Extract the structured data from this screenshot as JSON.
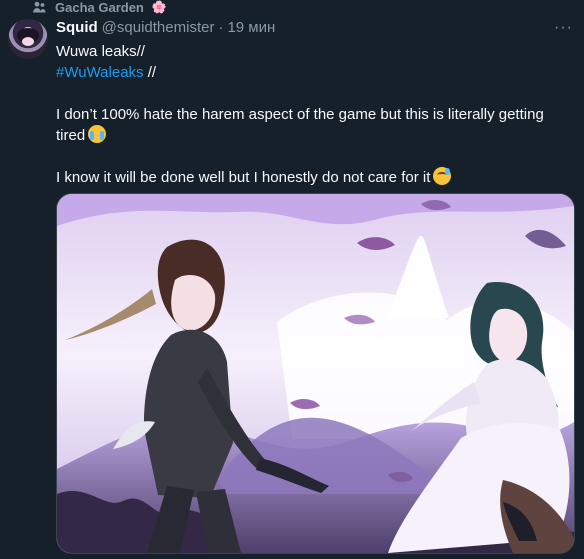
{
  "community": {
    "name": "Gacha Garden",
    "emoji": "🌸",
    "icon": "people-icon"
  },
  "tweet": {
    "display_name": "Squid",
    "handle": "@squidthemister",
    "separator": "·",
    "time": "19 мин",
    "more_icon": "more-icon",
    "text": {
      "line1": "Wuwa leaks//",
      "hashtag": "#WuWaleaks",
      "line2_suffix": " //",
      "paragraph2": "I don’t 100% hate the harem aspect of the game but this is literally getting tired",
      "paragraph3": "I know it will be done well but I honestly do not care for it"
    },
    "emojis": {
      "paragraph2": "loudly-crying-face",
      "paragraph3": "grinning-face-with-sweat"
    },
    "media": {
      "type": "image",
      "alt_semantic": "anime artwork of a dark-haired man and a woman with teal hair in a pastel landscape"
    }
  },
  "colors": {
    "background": "#15202b",
    "text_primary": "#f7f9f9",
    "text_secondary": "#8b98a5",
    "accent": "#1d9bf0",
    "border": "#38444d"
  }
}
